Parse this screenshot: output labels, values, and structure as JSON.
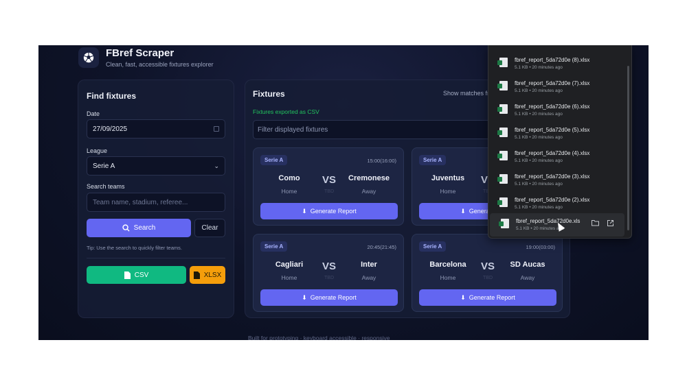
{
  "header": {
    "title": "FBref Scraper",
    "subtitle": "Clean, fast, accessible fixtures explorer"
  },
  "find": {
    "title": "Find fixtures",
    "date_label": "Date",
    "date_value": "27/09/2025",
    "league_label": "League",
    "league_value": "Serie A",
    "search_label": "Search teams",
    "search_placeholder": "Team name, stadium, referee...",
    "search_button": "Search",
    "clear_button": "Clear",
    "tip": "Tip: Use the search to quickly filter teams.",
    "csv_button": "CSV",
    "xlsx_button": "XLSX"
  },
  "fixtures": {
    "title": "Fixtures",
    "show_label": "Show matches fr",
    "status": "Fixtures exported as CSV",
    "filter_placeholder": "Filter displayed fixtures",
    "vs_label": "VS",
    "tbd_label": "TBD",
    "home_label": "Home",
    "away_label": "Away",
    "generate_label": "Generate Report",
    "cards": [
      {
        "league": "Serie A",
        "time": "15:00(16:00)",
        "home": "Como",
        "away": "Cremonese"
      },
      {
        "league": "Serie A",
        "time": "",
        "home": "Juventus",
        "away": ""
      },
      {
        "league": "Serie A",
        "time": "20:45(21:45)",
        "home": "Cagliari",
        "away": "Inter"
      },
      {
        "league": "Serie A",
        "time": "19:00(03:00)",
        "home": "Barcelona",
        "away": "SD Aucas"
      }
    ]
  },
  "footer": {
    "text": "Built for prototyping · keyboard accessible · responsive"
  },
  "downloads": {
    "items": [
      {
        "name": "fbref_report_5da72d0e (8).xlsx",
        "meta": "5.1 KB • 20 minutes ago"
      },
      {
        "name": "fbref_report_5da72d0e (7).xlsx",
        "meta": "5.1 KB • 20 minutes ago"
      },
      {
        "name": "fbref_report_5da72d0e (6).xlsx",
        "meta": "5.1 KB • 20 minutes ago"
      },
      {
        "name": "fbref_report_5da72d0e (5).xlsx",
        "meta": "5.1 KB • 20 minutes ago"
      },
      {
        "name": "fbref_report_5da72d0e (4).xlsx",
        "meta": "5.1 KB • 20 minutes ago"
      },
      {
        "name": "fbref_report_5da72d0e (3).xlsx",
        "meta": "5.1 KB • 20 minutes ago"
      },
      {
        "name": "fbref_report_5da72d0e (2).xlsx",
        "meta": "5.1 KB • 20 minutes ago"
      },
      {
        "name": "fbref_report_5da72d0e.xls",
        "meta": "5.1 KB • 20 minutes ago"
      }
    ]
  },
  "colors": {
    "accent": "#6366f1",
    "csv": "#10b981",
    "xlsx": "#f59e0b",
    "success": "#22c55e"
  }
}
